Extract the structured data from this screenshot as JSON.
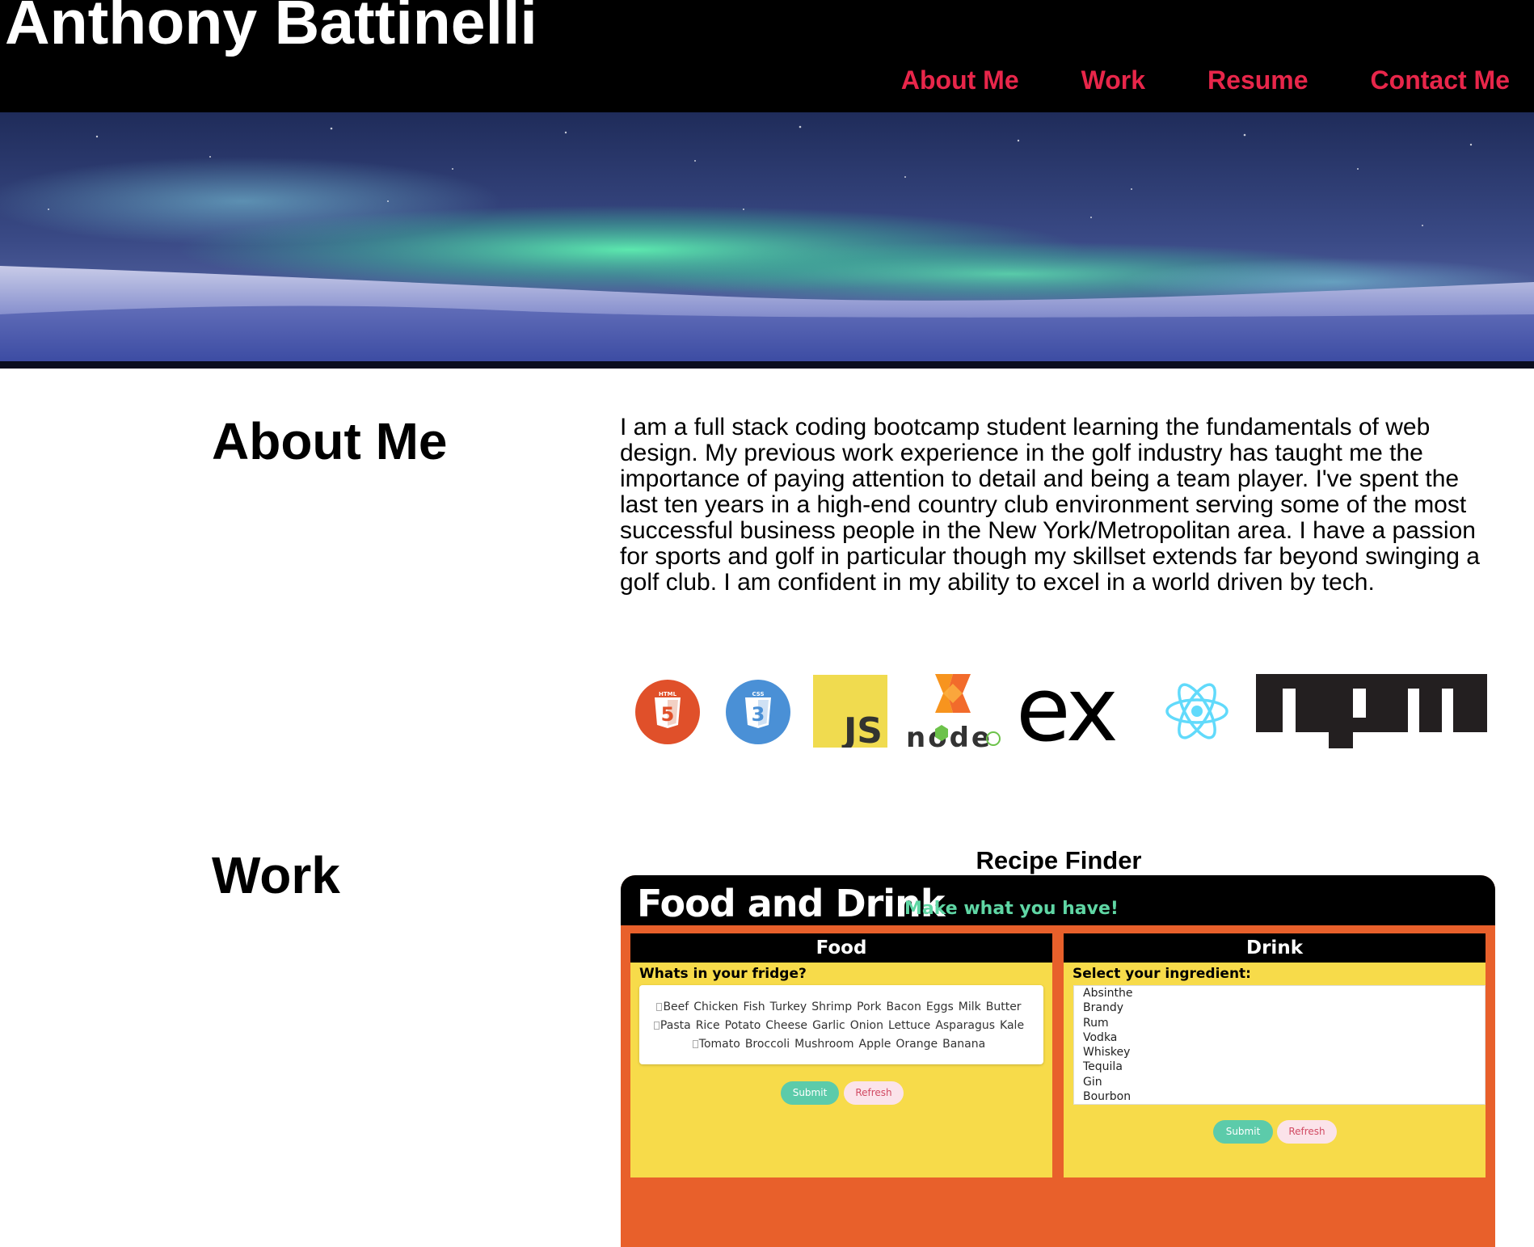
{
  "header": {
    "title": "Anthony Battinelli",
    "nav": [
      "About Me",
      "Work",
      "Resume",
      "Contact Me"
    ]
  },
  "about": {
    "heading": "About Me",
    "text": "I am a full stack coding bootcamp student learning the fundamentals of web design. My previous work experience in the golf industry has taught me the importance of paying attention to detail and being a team player. I've spent the last ten years in a high-end country club environment serving some of the most successful business people in the New York/Metropolitan area. I have a passion for sports and golf in particular though my skillset extends far beyond swinging a golf club. I am confident in my ability to excel in a world driven by tech.",
    "logos": {
      "html": "HTML",
      "css": "CSS",
      "js": "JS",
      "node": "node",
      "express": "ex",
      "npm": "npm"
    }
  },
  "work": {
    "heading": "Work",
    "project": {
      "title": "Recipe Finder",
      "app_title": "Food and Drink",
      "tagline": "Make what you have!",
      "food": {
        "header": "Food",
        "label": "Whats in your fridge?",
        "ingredients": [
          "Beef",
          "Chicken",
          "Fish",
          "Turkey",
          "Shrimp",
          "Pork",
          "Bacon",
          "Eggs",
          "Milk",
          "Butter",
          "Pasta",
          "Rice",
          "Potato",
          "Cheese",
          "Garlic",
          "Onion",
          "Lettuce",
          "Asparagus",
          "Kale",
          "Tomato",
          "Broccoli",
          "Mushroom",
          "Apple",
          "Orange",
          "Banana"
        ],
        "submit": "Submit",
        "refresh": "Refresh"
      },
      "drink": {
        "header": "Drink",
        "label": "Select your ingredient:",
        "options": [
          "Absinthe",
          "Brandy",
          "Rum",
          "Vodka",
          "Whiskey",
          "Tequila",
          "Gin",
          "Bourbon"
        ],
        "submit": "Submit",
        "refresh": "Refresh"
      }
    }
  },
  "colors": {
    "nav_link": "#e8264a",
    "app_orange": "#e8602b",
    "panel_yellow": "#f7db4a",
    "accent_green": "#5fd6a4"
  }
}
